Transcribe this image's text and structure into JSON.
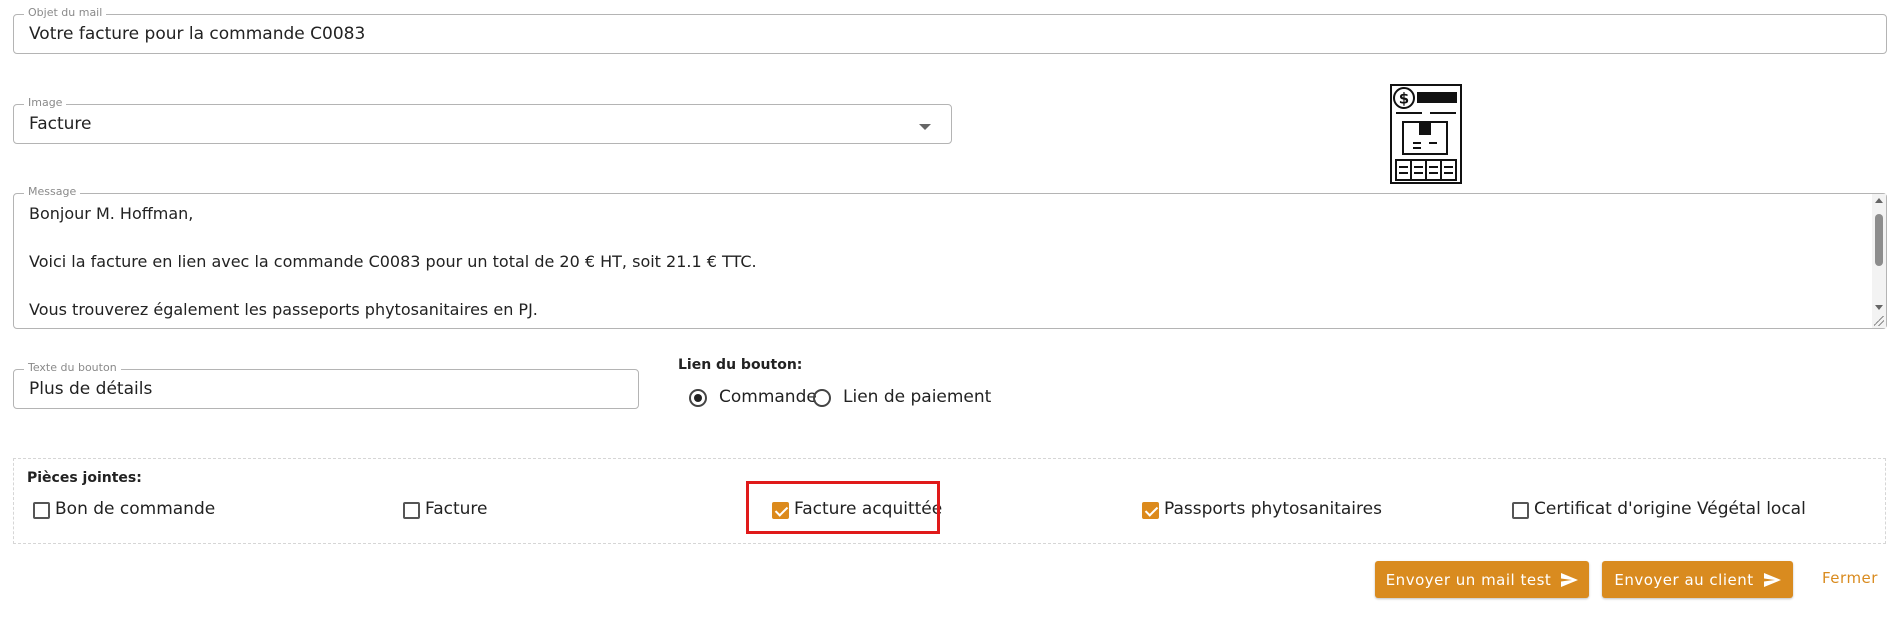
{
  "subject": {
    "label": "Objet du mail",
    "value": "Votre facture pour la commande C0083"
  },
  "image": {
    "label": "Image",
    "value": "Facture",
    "icon": "invoice-icon"
  },
  "message": {
    "label": "Message",
    "lines": [
      "Bonjour M. Hoffman,",
      "",
      "Voici la facture en lien avec la commande C0083 pour un total de 20 € HT, soit 21.1 € TTC.",
      "",
      "Vous trouverez également les passeports phytosanitaires en PJ."
    ]
  },
  "button_text": {
    "label": "Texte du bouton",
    "value": "Plus de détails"
  },
  "button_link": {
    "label": "Lien du bouton:",
    "options": [
      {
        "label": "Commande",
        "checked": true
      },
      {
        "label": "Lien de paiement",
        "checked": false
      }
    ]
  },
  "attachments": {
    "label": "Pièces jointes:",
    "items": [
      {
        "label": "Bon de commande",
        "checked": false
      },
      {
        "label": "Facture",
        "checked": false
      },
      {
        "label": "Facture acquittée",
        "checked": true
      },
      {
        "label": "Passports phytosanitaires",
        "checked": true
      },
      {
        "label": "Certificat d'origine Végétal local",
        "checked": false
      }
    ]
  },
  "actions": {
    "send_test": "Envoyer un mail test",
    "send_client": "Envoyer au client",
    "close": "Fermer"
  },
  "colors": {
    "accent": "#d98b1f",
    "highlight": "#e01a1a"
  }
}
